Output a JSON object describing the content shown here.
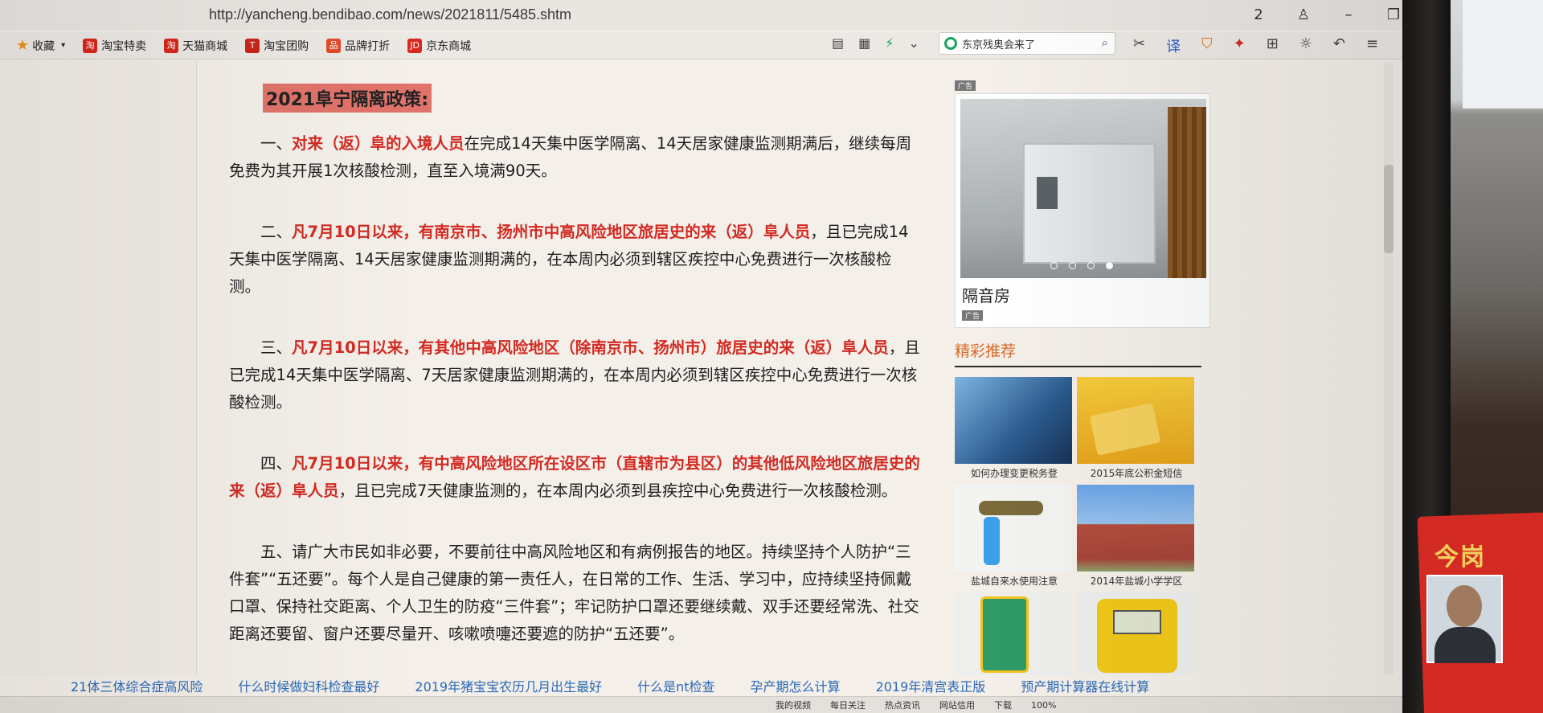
{
  "browser": {
    "url": "http://yancheng.bendibao.com/news/2021811/5485.shtm",
    "tab_count": "2",
    "search_placeholder": "东京残奥会来了"
  },
  "bookmarks": [
    {
      "label": "收藏",
      "icon": "star-icon"
    },
    {
      "label": "淘宝特卖",
      "icon": "taobao-icon"
    },
    {
      "label": "天猫商城",
      "icon": "tmall-icon"
    },
    {
      "label": "淘宝团购",
      "icon": "tuan-icon"
    },
    {
      "label": "品牌打折",
      "icon": "brand-icon"
    },
    {
      "label": "京东商城",
      "icon": "jd-icon"
    }
  ],
  "article": {
    "heading": "2021阜宁隔离政策:",
    "paragraphs": [
      {
        "prefix": "一、",
        "red": "对来（返）阜的入境人员",
        "rest": "在完成14天集中医学隔离、14天居家健康监测期满后，继续每周免费为其开展1次核酸检测，直至入境满90天。"
      },
      {
        "prefix": "二、",
        "red": "凡7月10日以来，有南京市、扬州市中高风险地区旅居史的来（返）阜人员",
        "rest": "，且已完成14天集中医学隔离、14天居家健康监测期满的，在本周内必须到辖区疾控中心免费进行一次核酸检测。"
      },
      {
        "prefix": "三、",
        "red": "凡7月10日以来，有其他中高风险地区（除南京市、扬州市）旅居史的来（返）阜人员",
        "rest": "，且已完成14天集中医学隔离、7天居家健康监测期满的，在本周内必须到辖区疾控中心免费进行一次核酸检测。"
      },
      {
        "prefix": "四、",
        "red": "凡7月10日以来，有中高风险地区所在设区市（直辖市为县区）的其他低风险地区旅居史的来（返）阜人员",
        "rest": "，且已完成7天健康监测的，在本周内必须到县疾控中心免费进行一次核酸检测。"
      },
      {
        "prefix": "五、",
        "red": "",
        "rest": "请广大市民如非必要，不要前往中高风险地区和有病例报告的地区。持续坚持个人防护“三件套”“五还要”。每个人是自己健康的第一责任人，在日常的工作、生活、学习中，应持续坚持佩戴口罩、保持社交距离、个人卫生的防疫“三件套”；牢记防护口罩还要继续戴、双手还要经常洗、社交距离还要留、窗户还要尽量开、咳嗽喷嚏还要遮的防护“五还要”。"
      }
    ]
  },
  "ad": {
    "tag": "广告",
    "caption": "隔音房",
    "slides_total": 4,
    "slide_active": 4
  },
  "recommend": {
    "title": "精彩推荐",
    "items": [
      {
        "label": "如何办理变更税务登"
      },
      {
        "label": "2015年底公积金短信"
      },
      {
        "label": "盐城自来水使用注意"
      },
      {
        "label": "2014年盐城小学学区"
      },
      {
        "label": ""
      },
      {
        "label": ""
      }
    ]
  },
  "bottom_links": [
    "21体三体综合症高风险",
    "什么时候做妇科检查最好",
    "2019年猪宝宝农历几月出生最好",
    "什么是nt检查",
    "孕产期怎么计算",
    "2019年清宫表正版",
    "预产期计算器在线计算"
  ],
  "statusbar": [
    "我的视频",
    "每日关注",
    "热点资讯",
    "网站信用",
    "下载",
    "100%"
  ],
  "poster": {
    "text": "今岗"
  }
}
